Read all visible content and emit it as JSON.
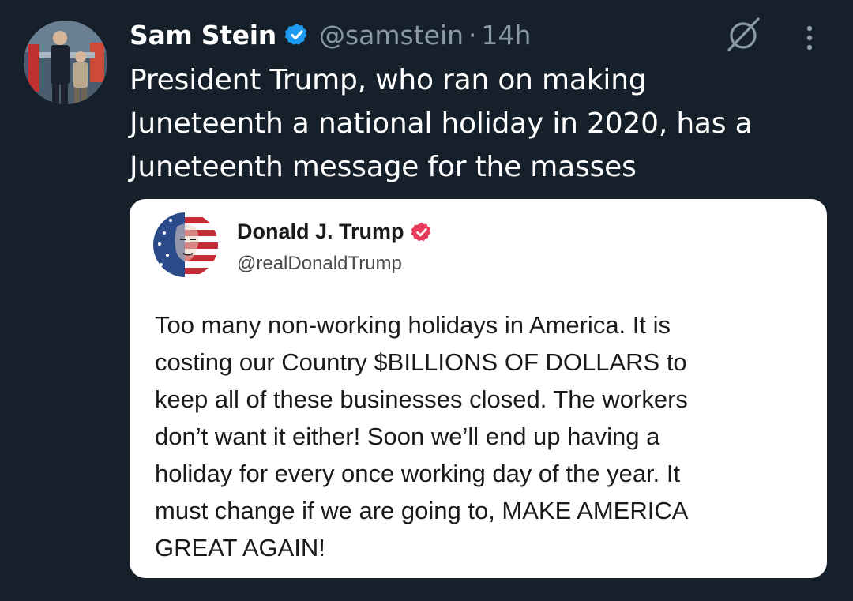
{
  "tweet": {
    "author": {
      "name": "Sam Stein",
      "handle": "@samstein",
      "separator": "·",
      "time": "14h",
      "verified": true,
      "avatar": "person-photo-avatar"
    },
    "icons": {
      "grok": "grok-icon",
      "more": "more-icon"
    },
    "text_lines": [
      "President Trump, who ran on making",
      "Juneteenth a national holiday in 2020, has a",
      "Juneteenth message for the masses"
    ],
    "quoted_post": {
      "name": "Donald J. Trump",
      "handle": "@realDonaldTrump",
      "verified": true,
      "avatar": "flag-portrait-avatar",
      "text_lines": [
        "Too many non-working holidays in America. It is",
        "costing our Country $BILLIONS OF DOLLARS to",
        "keep all of these businesses closed. The workers",
        "don’t want it either! Soon we’ll end up having a",
        "holiday for every once working day of the year. It",
        "must change if we are going to, MAKE AMERICA",
        "GREAT AGAIN!"
      ]
    }
  },
  "colors": {
    "background": "#15202b",
    "text_primary": "#ffffff",
    "text_secondary": "#8b98a5",
    "verified_blue": "#1d9bf0",
    "truth_verified_red": "#e63b5a",
    "card_background": "#ffffff",
    "card_text": "#1a1a1a"
  }
}
